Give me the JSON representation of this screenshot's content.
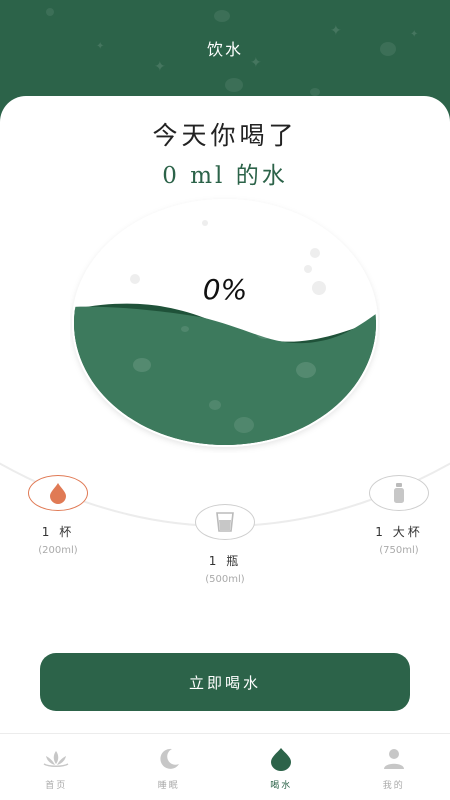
{
  "header": {
    "title": "饮水"
  },
  "summary": {
    "line1": "今天你喝了",
    "line2": "0 ml 的水"
  },
  "gauge": {
    "percent_label": "0%",
    "fill_level": 0.4,
    "wave_color": "#2c6349"
  },
  "options": [
    {
      "label": "1 杯",
      "volume": "(200ml)",
      "icon": "water-drop-icon",
      "active": true
    },
    {
      "label": "1 瓶",
      "volume": "(500ml)",
      "icon": "glass-icon",
      "active": false
    },
    {
      "label": "1 大杯",
      "volume": "(750ml)",
      "icon": "bottle-icon",
      "active": false
    }
  ],
  "action": {
    "drink_now": "立即喝水"
  },
  "tabs": [
    {
      "label": "首页",
      "icon": "lotus-icon",
      "active": false
    },
    {
      "label": "睡眠",
      "icon": "moon-icon",
      "active": false
    },
    {
      "label": "喝水",
      "icon": "leaf-drop-icon",
      "active": true
    },
    {
      "label": "我的",
      "icon": "person-icon",
      "active": false
    }
  ],
  "colors": {
    "primary": "#2c6349",
    "accent": "#e07a55",
    "inactive": "#c7c7c7"
  }
}
